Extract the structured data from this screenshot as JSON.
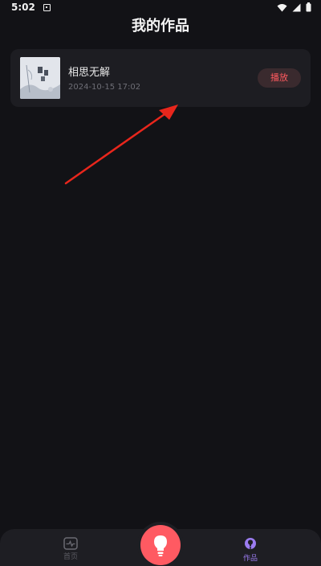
{
  "status_bar": {
    "time": "5:02"
  },
  "header": {
    "title": "我的作品"
  },
  "works": [
    {
      "title": "相思无解",
      "datetime": "2024-10-15 17:02",
      "play_label": "播放"
    }
  ],
  "nav": {
    "home_label": "首页",
    "works_label": "作品"
  },
  "colors": {
    "background": "#121216",
    "card": "#1d1d22",
    "accent_red": "#ff5a62",
    "accent_purple": "#9b7cf0",
    "arrow": "#e8261c"
  },
  "icons": {
    "wifi": "wifi-icon",
    "signal": "signal-icon",
    "battery": "battery-icon",
    "home": "pulse-icon",
    "center": "lightbulb-icon",
    "works": "bulb-badge-icon"
  }
}
